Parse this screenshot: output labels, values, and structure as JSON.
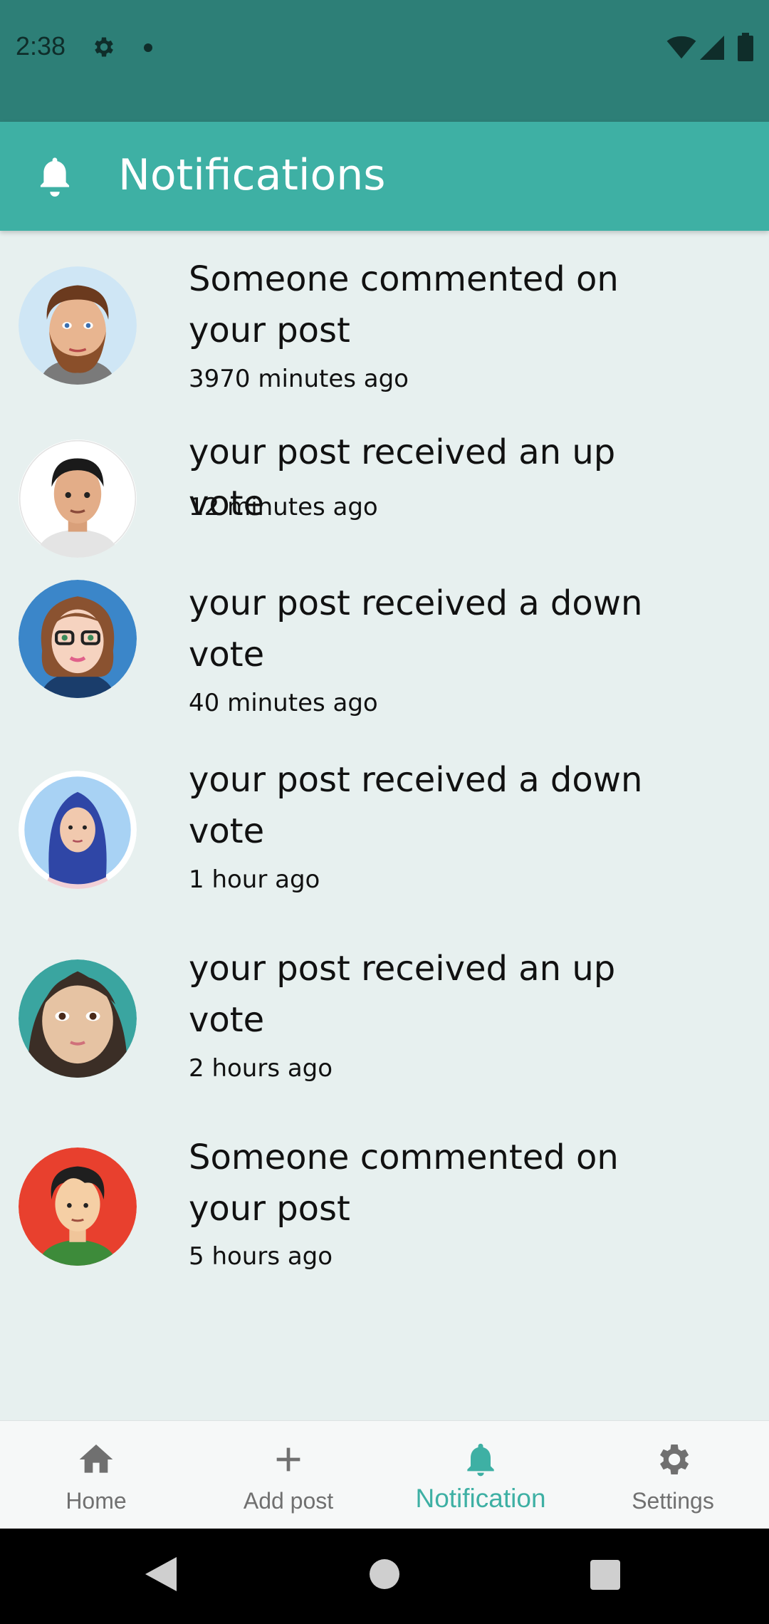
{
  "status_bar": {
    "time": "2:38",
    "icons": [
      "gear-icon",
      "dot-icon",
      "wifi-icon",
      "signal-icon",
      "battery-icon"
    ]
  },
  "app_bar": {
    "icon": "bell-icon",
    "title": "Notifications"
  },
  "notifications": [
    {
      "avatar": "bearded-man-avatar",
      "message": "Someone commented on your post",
      "time": "3970 minutes ago"
    },
    {
      "avatar": "man-avatar",
      "message": "your post received an up vote",
      "time": "12 minutes ago"
    },
    {
      "avatar": "woman-glasses-avatar",
      "message": "your post received a down vote",
      "time": "40 minutes ago"
    },
    {
      "avatar": "woman-hijab-avatar",
      "message": "your post received a down vote",
      "time": "1 hour ago"
    },
    {
      "avatar": "woman-dark-hair-avatar",
      "message": "your post received an up vote",
      "time": "2 hours ago"
    },
    {
      "avatar": "boy-avatar",
      "message": "Someone commented on your post",
      "time": "5 hours ago"
    }
  ],
  "bottom_nav": {
    "items": [
      {
        "label": "Home",
        "icon": "home-icon",
        "active": false
      },
      {
        "label": "Add post",
        "icon": "plus-icon",
        "active": false
      },
      {
        "label": "Notification",
        "icon": "bell-icon",
        "active": true
      },
      {
        "label": "Settings",
        "icon": "gear-icon",
        "active": false
      }
    ]
  },
  "colors": {
    "status_bar": "#2d7f77",
    "app_bar": "#3eb0a4",
    "background": "#e7f0ef",
    "accent": "#3eb0a4",
    "nav_inactive": "#707070"
  }
}
